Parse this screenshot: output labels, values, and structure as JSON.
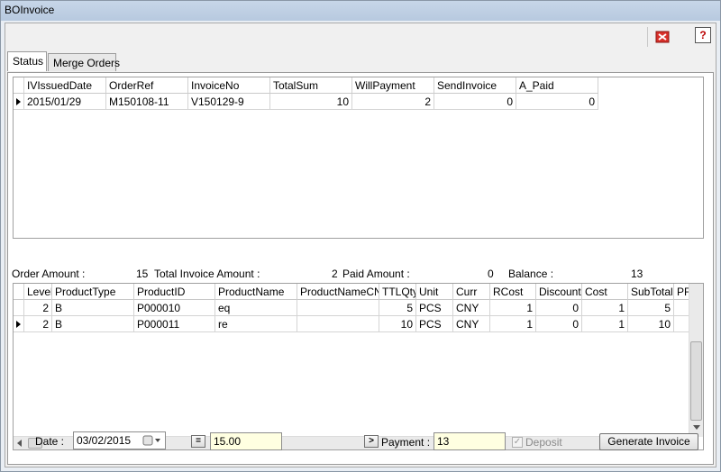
{
  "window": {
    "title": "BOInvoice"
  },
  "toolbar": {
    "help_label": "?"
  },
  "tabs": [
    {
      "label": "Status"
    },
    {
      "label": "Merge Orders"
    }
  ],
  "top_grid": {
    "columns": [
      "IVIssuedDate",
      "OrderRef",
      "InvoiceNo",
      "TotalSum",
      "WillPayment",
      "SendInvoice",
      "A_Paid"
    ],
    "rows": [
      [
        "2015/01/29",
        "M150108-11",
        "V150129-9",
        "10",
        "2",
        "0",
        "0"
      ]
    ]
  },
  "summary": {
    "order_amount_label": "Order Amount :",
    "order_amount_value": "15",
    "total_invoice_label": "Total Invoice Amount :",
    "total_invoice_value": "2",
    "paid_amount_label": "Paid  Amount :",
    "paid_amount_value": "0",
    "balance_label": "Balance :",
    "balance_value": "13"
  },
  "bottom_grid": {
    "columns": [
      "Level",
      "ProductType",
      "ProductID",
      "ProductName",
      "ProductNameCN",
      "TTLQty",
      "Unit",
      "Curr",
      "RCost",
      "Discount",
      "Cost",
      "SubTotal",
      "PF"
    ],
    "rows": [
      [
        "2",
        "B",
        "P000010",
        "eq",
        "",
        "5",
        "PCS",
        "CNY",
        "1",
        "0",
        "1",
        "5",
        ""
      ],
      [
        "2",
        "B",
        "P000011",
        "re",
        "",
        "10",
        "PCS",
        "CNY",
        "1",
        "0",
        "1",
        "10",
        ""
      ]
    ]
  },
  "footer": {
    "date_label": "Date :",
    "date_value": "03/02/2015",
    "equals_label": "=",
    "amount_value": "15.00",
    "payment_button_label": ">",
    "payment_label": "Payment :",
    "payment_value": "13",
    "deposit_label": "Deposit",
    "generate_label": "Generate Invoice"
  }
}
